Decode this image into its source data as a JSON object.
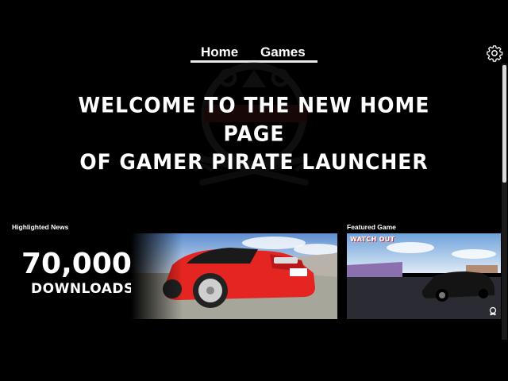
{
  "nav": {
    "tabs": [
      {
        "label": "Home"
      },
      {
        "label": "Games"
      }
    ]
  },
  "hero": {
    "line1": "Welcome to the new home page",
    "line2": "of Gamer Pirate Launcher"
  },
  "news": {
    "section_label": "Highlighted News",
    "count": "70,000",
    "count_label": "DOWNLOADS",
    "image_icon": "red-car-image"
  },
  "featured": {
    "section_label": "Featured Game",
    "title_overlay": "WATCH OUT",
    "image_icon": "black-car-image",
    "corner_icon": "skull-icon"
  },
  "icons": {
    "settings": "gear-icon"
  },
  "colors": {
    "background": "#000000",
    "car_red": "#e52521",
    "sky": "#8ab8e6"
  }
}
